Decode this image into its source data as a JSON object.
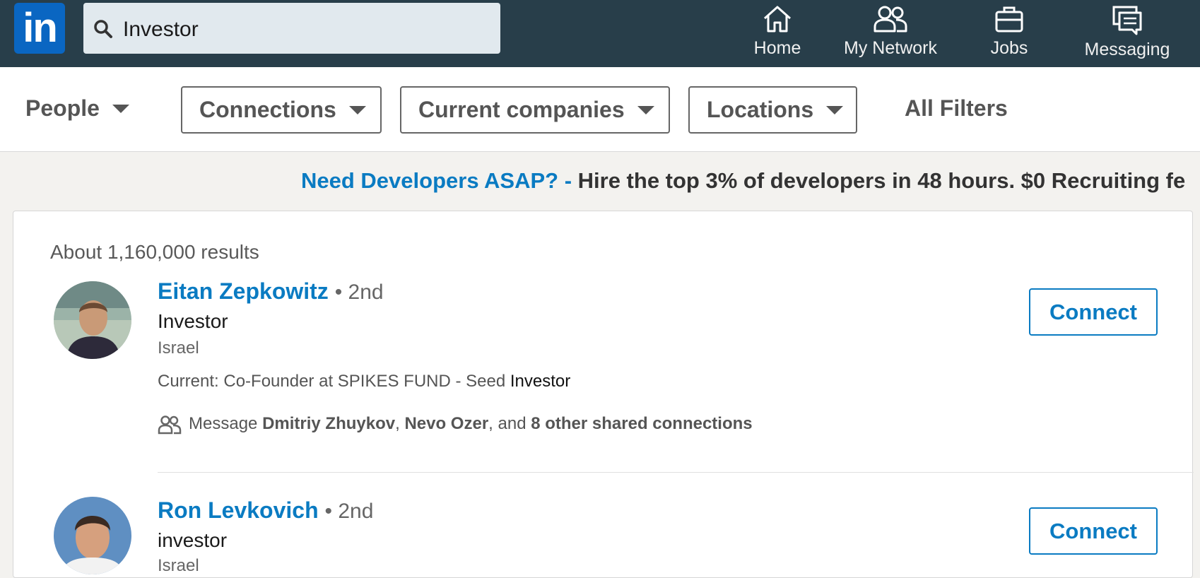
{
  "nav": {
    "logo_text": "in",
    "search_value": "Investor",
    "items": [
      {
        "label": "Home",
        "icon": "home-icon"
      },
      {
        "label": "My Network",
        "icon": "network-icon"
      },
      {
        "label": "Jobs",
        "icon": "briefcase-icon"
      },
      {
        "label": "Messaging",
        "icon": "messaging-icon"
      }
    ]
  },
  "filters": {
    "people_label": "People",
    "connections_label": "Connections",
    "companies_label": "Current companies",
    "locations_label": "Locations",
    "all_filters_label": "All Filters"
  },
  "promo": {
    "highlight": "Need Developers ASAP? -",
    "text": " Hire the top 3% of developers in 48 hours. $0 Recruiting fe"
  },
  "results": {
    "count_text": "About 1,160,000 results",
    "items": [
      {
        "name": "Eitan Zepkowitz",
        "degree": "• 2nd",
        "headline": "Investor",
        "location": "Israel",
        "current_prefix": "Current: Co-Founder at SPIKES FUND - Seed ",
        "current_highlight": "Investor",
        "shared_prefix": "Message ",
        "shared_name1": "Dmitriy Zhuykov",
        "shared_sep1": ", ",
        "shared_name2": "Nevo Ozer",
        "shared_sep2": ", and ",
        "shared_more": "8 other shared connections",
        "connect_label": "Connect"
      },
      {
        "name": "Ron Levkovich",
        "degree": "• 2nd",
        "headline": "investor",
        "location": "Israel",
        "connect_label": "Connect"
      }
    ]
  },
  "colors": {
    "nav_bg": "#283e4a",
    "brand_blue": "#0a66c2",
    "link_blue": "#0a7bc2"
  }
}
